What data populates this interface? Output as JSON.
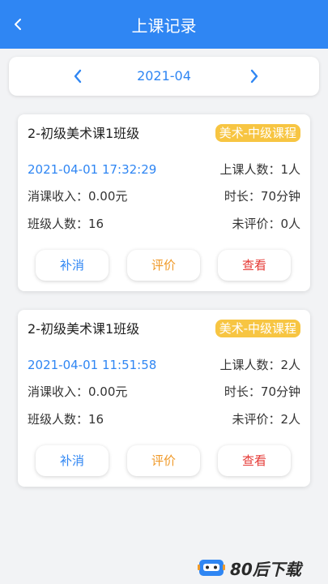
{
  "header": {
    "title": "上课记录",
    "back_icon": "chevron-left-icon"
  },
  "month_selector": {
    "current": "2021-04",
    "prev_icon": "chevron-left-icon",
    "next_icon": "chevron-right-icon",
    "accent": "#2f86f3"
  },
  "records": [
    {
      "class_name": "2-初级美术课1班级",
      "course_tag": "美术-中级课程",
      "datetime": "2021-04-01 17:32:29",
      "attendees": "上课人数：1人",
      "income": "消课收入：0.00元",
      "duration": "时长：70分钟",
      "class_size": "班级人数：16",
      "unrated": "未评价：0人",
      "buttons": {
        "makeup": "补消",
        "rate": "评价",
        "view": "查看"
      }
    },
    {
      "class_name": "2-初级美术课1班级",
      "course_tag": "美术-中级课程",
      "datetime": "2021-04-01 11:51:58",
      "attendees": "上课人数：2人",
      "income": "消课收入：0.00元",
      "duration": "时长：70分钟",
      "class_size": "班级人数：16",
      "unrated": "未评价：2人",
      "buttons": {
        "makeup": "补消",
        "rate": "评价",
        "view": "查看"
      }
    }
  ],
  "watermark": {
    "text": "80后下载"
  },
  "colors": {
    "primary": "#2f86f3",
    "tag": "#f7c542",
    "rate": "#f09a2a",
    "view": "#e53935"
  }
}
